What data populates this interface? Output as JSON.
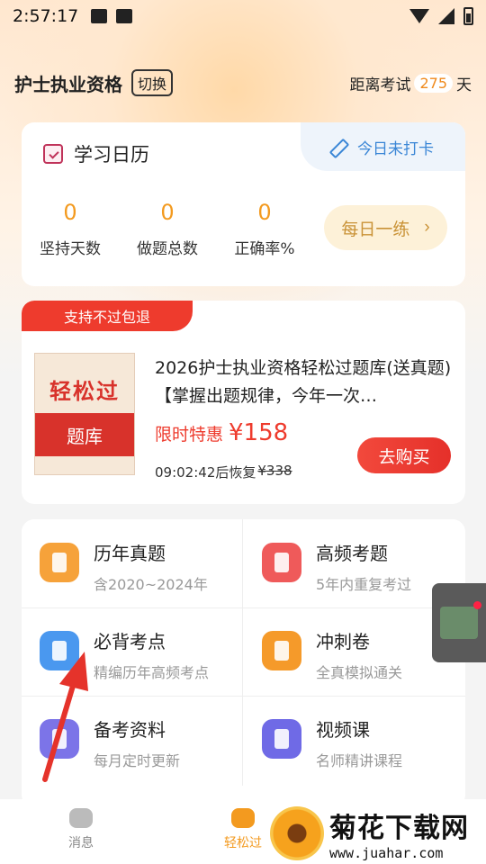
{
  "status_bar": {
    "time": "2:57:17"
  },
  "header": {
    "title": "护士执业资格",
    "switch_label": "切换",
    "exam_prefix": "距离考试",
    "exam_days": "275",
    "exam_suffix": "天"
  },
  "calendar": {
    "title": "学习日历",
    "checkin_label": "今日未打卡",
    "stats": [
      {
        "value": "0",
        "label": "坚持天数"
      },
      {
        "value": "0",
        "label": "做题总数"
      },
      {
        "value": "0",
        "label": "正确率%"
      }
    ],
    "daily_button": "每日一练"
  },
  "promo": {
    "tag": "支持不过包退",
    "cover_top": "轻松过",
    "cover_bottom": "题库",
    "title": "2026护士执业资格轻松过题库(送真题)【掌握出题规律，今年一次…",
    "price_label": "限时特惠",
    "price": "¥158",
    "timer": "09:02:42后恢复",
    "original_price": "¥338",
    "buy_label": "去购买"
  },
  "grid": [
    {
      "title": "历年真题",
      "subtitle": "含2020~2024年",
      "icon": "doc-list-icon",
      "color": "#f6a23a"
    },
    {
      "title": "高频考题",
      "subtitle": "5年内重复考过",
      "icon": "star-doc-icon",
      "color": "#ef5a5a"
    },
    {
      "title": "必背考点",
      "subtitle": "精编历年高频考点",
      "icon": "copy-doc-icon",
      "color": "#4a98ef"
    },
    {
      "title": "冲刺卷",
      "subtitle": "全真模拟通关",
      "icon": "lightning-doc-icon",
      "color": "#f59a2a"
    },
    {
      "title": "备考资料",
      "subtitle": "每月定时更新",
      "icon": "book-icon",
      "color": "#7c74e8"
    },
    {
      "title": "视频课",
      "subtitle": "名师精讲课程",
      "icon": "play-icon",
      "color": "#6f6ae6"
    }
  ],
  "bottom_nav": [
    {
      "label": "消息"
    },
    {
      "label": "轻松过"
    }
  ],
  "watermark": {
    "text": "菊花下载网",
    "url": "www.juahar.com"
  }
}
